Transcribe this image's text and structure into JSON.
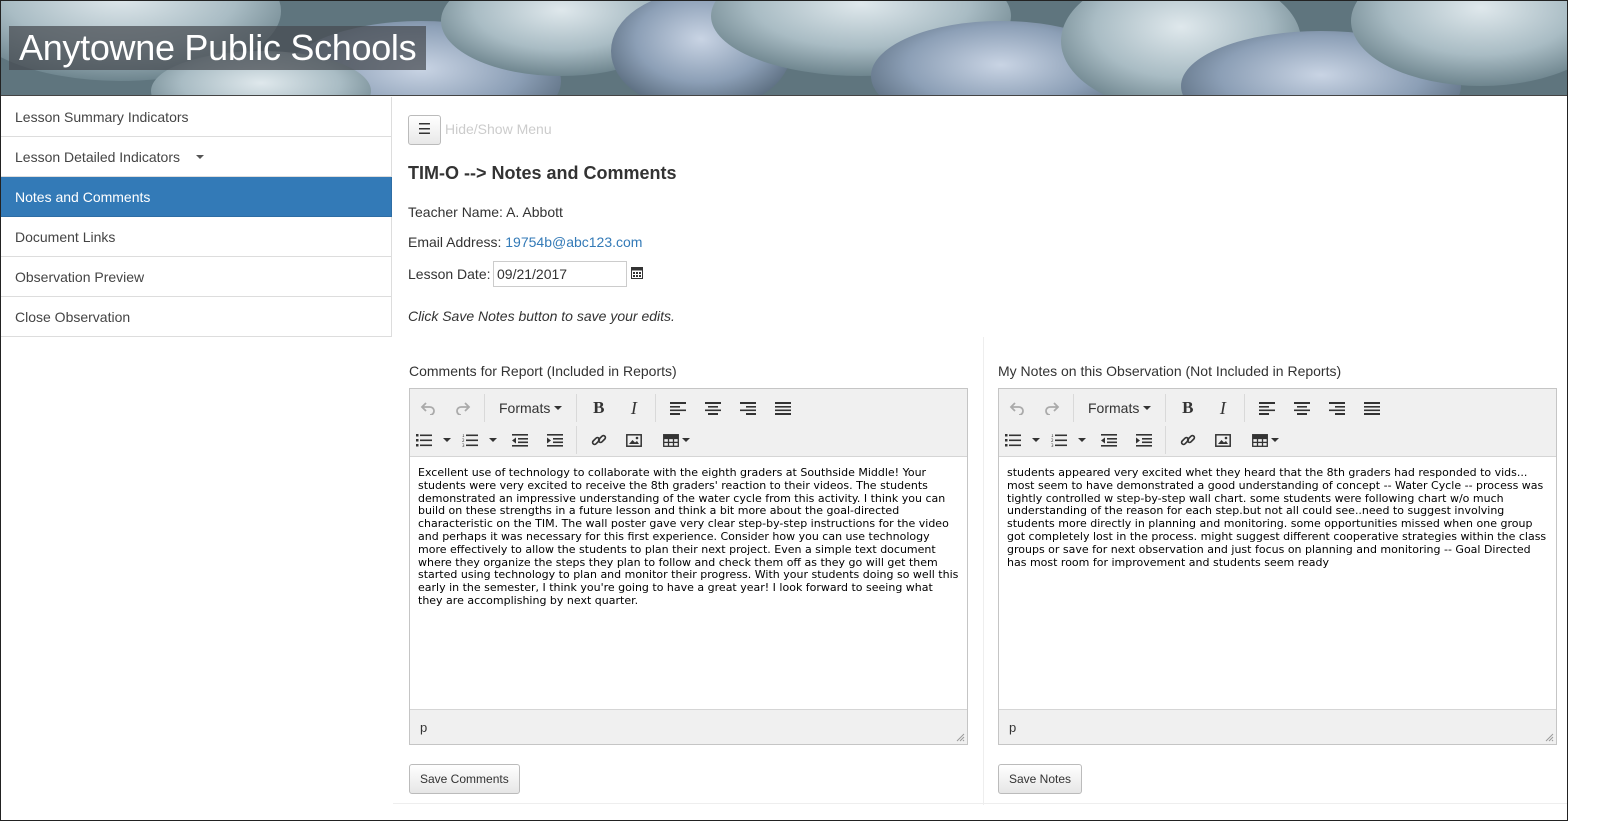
{
  "app": {
    "title": "Anytowne Public Schools"
  },
  "sidebar": {
    "items": [
      {
        "label": "Lesson Summary Indicators"
      },
      {
        "label": "Lesson Detailed Indicators"
      },
      {
        "label": "Notes and Comments"
      },
      {
        "label": "Document Links"
      },
      {
        "label": "Observation Preview"
      },
      {
        "label": "Close Observation"
      }
    ],
    "active_index": 2
  },
  "main": {
    "menu_toggle_label": "Hide/Show Menu",
    "page_title": "TIM-O --> Notes and Comments",
    "teacher_label": "Teacher Name:",
    "teacher_name": "A. Abbott",
    "email_label": "Email Address:",
    "email": "19754b@abc123.com",
    "date_label": "Lesson Date:",
    "date_value": "09/21/2017",
    "hint": "Click Save Notes button to save your edits."
  },
  "comments": {
    "title": "Comments for Report (Included in Reports)",
    "formats_label": "Formats",
    "body": "Excellent use of technology to collaborate with the eighth graders at Southside Middle! Your students were very excited to receive the 8th graders' reaction to their videos. The students demonstrated an impressive understanding of the water cycle from this activity. I think you can build on these strengths in a future lesson and think a bit more about the goal-directed characteristic on the TIM. The wall poster gave very clear step-by-step instructions for the video and perhaps it was necessary for this first experience. Consider how you can use technology more effectively to allow the students to plan their next project. Even a simple text document where they organize the steps they plan to follow and check them off as they go will get them started using technology to plan and monitor their progress. With your students doing so well this early in the semester, I think you're going to have a great year! I look forward to seeing what they are accomplishing by next quarter.",
    "status_path": "p",
    "save_label": "Save Comments"
  },
  "notes": {
    "title": "My Notes on this Observation (Not Included in Reports)",
    "formats_label": "Formats",
    "body": "students appeared very excited whet they heard that the 8th graders had responded to vids... most seem to have demonstrated a good understanding of concept -- Water Cycle -- process was tightly controlled w step-by-step wall chart. some students were following chart w/o much understanding of the reason for each step.but not all could see..need to suggest involving students more directly in planning and monitoring. some opportunities missed when one group got completely lost in the process. might suggest different cooperative strategies  within the class groups or save for next observation and just focus on planning and monitoring -- Goal Directed has most room for improvement and students seem ready",
    "status_path": "p",
    "save_label": "Save Notes"
  },
  "colors": {
    "accent": "#337ab7",
    "banner_overlay": "#464b50"
  }
}
